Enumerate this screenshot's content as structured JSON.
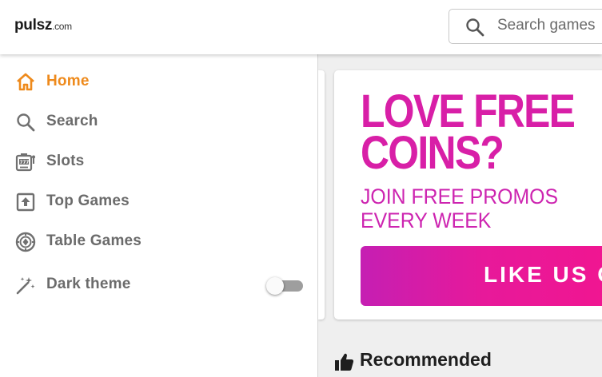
{
  "header": {
    "logo_main": "pulsz",
    "logo_domain": ".com",
    "search_placeholder": "Search games"
  },
  "sidebar": {
    "items": [
      {
        "label": "Home",
        "icon": "home-icon",
        "active": true
      },
      {
        "label": "Search",
        "icon": "search-icon",
        "active": false
      },
      {
        "label": "Slots",
        "icon": "slot-machine-icon",
        "active": false
      },
      {
        "label": "Top Games",
        "icon": "upload-box-icon",
        "active": false
      },
      {
        "label": "Table Games",
        "icon": "casino-chip-icon",
        "active": false
      }
    ],
    "dark_theme": {
      "label": "Dark theme",
      "icon": "dark-theme-icon",
      "enabled": false
    }
  },
  "promo": {
    "title": "LOVE FREE\nCOINS?",
    "subtitle": "JOIN FREE PROMOS\nEVERY WEEK",
    "button_label": "LIKE US O"
  },
  "recommended": {
    "heading": "Recommended",
    "icon": "thumbs-up-icon"
  },
  "colors": {
    "accent": "#ee8a1c",
    "promo_pink": "#d81fa7",
    "nav_text": "#6b6b6b"
  }
}
